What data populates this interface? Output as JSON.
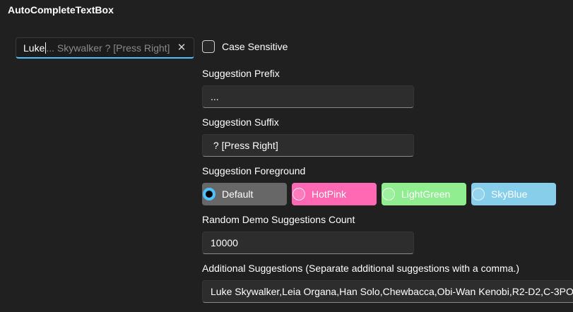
{
  "page": {
    "title": "AutoCompleteTextBox"
  },
  "autocomplete": {
    "typed": "Luke",
    "suggestion": "... Skywalker ? [Press Right]",
    "clear_glyph": "✕"
  },
  "case_sensitive": {
    "label": "Case Sensitive",
    "checked": false
  },
  "prefix": {
    "label": "Suggestion Prefix",
    "value": "..."
  },
  "suffix": {
    "label": "Suggestion Suffix",
    "value": " ? [Press Right]"
  },
  "foreground": {
    "label": "Suggestion Foreground",
    "options": [
      {
        "label": "Default",
        "bg": "#676767",
        "fg": "#ffffff",
        "selected": true
      },
      {
        "label": "HotPink",
        "bg": "#ff69b4",
        "fg": "#ffffff",
        "selected": false
      },
      {
        "label": "LightGreen",
        "bg": "#90ee90",
        "fg": "#ffffff",
        "selected": false
      },
      {
        "label": "SkyBlue",
        "bg": "#87ceeb",
        "fg": "#ffffff",
        "selected": false
      }
    ]
  },
  "random_count": {
    "label": "Random Demo Suggestions Count",
    "value": "10000"
  },
  "additional": {
    "label": "Additional Suggestions (Separate additional suggestions with a comma.)",
    "value": "Luke Skywalker,Leia Organa,Han Solo,Chewbacca,Obi-Wan Kenobi,R2-D2,C-3PO"
  },
  "colors": {
    "accent": "#4cc2ff",
    "background": "#202020",
    "field": "#2d2d2d"
  }
}
